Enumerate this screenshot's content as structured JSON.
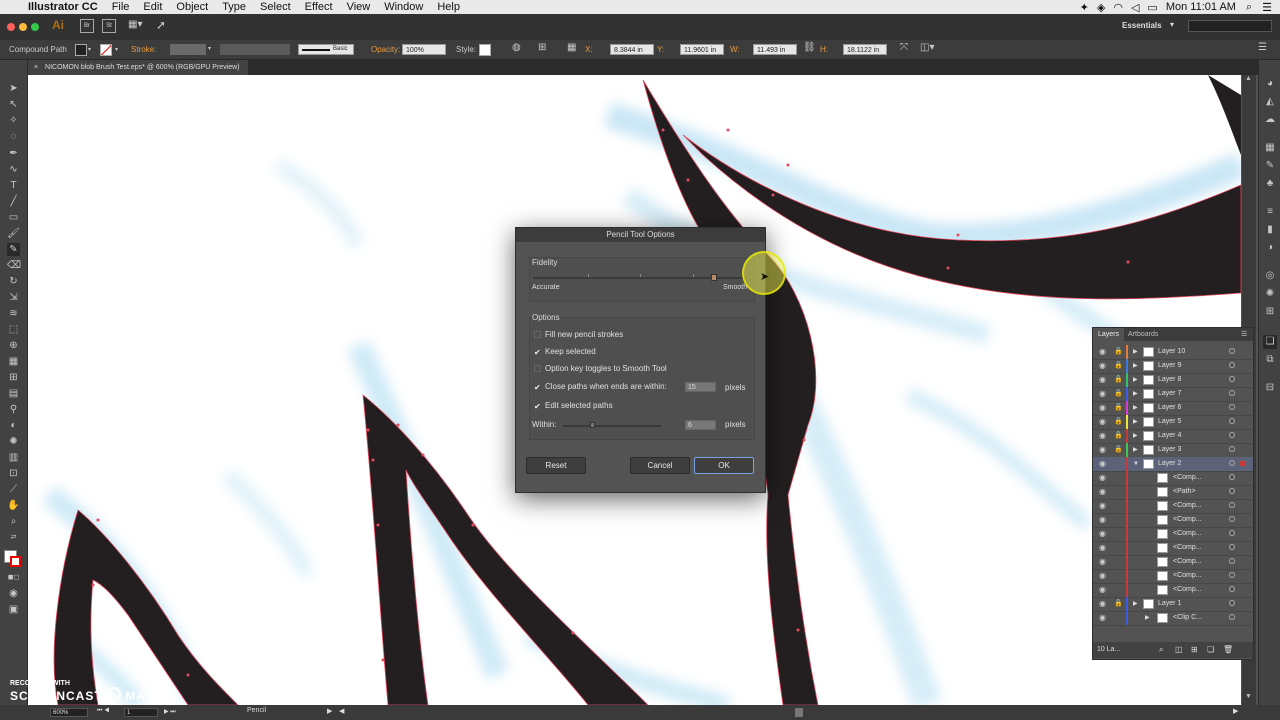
{
  "menubar": {
    "app_name": "Illustrator CC",
    "items": [
      "File",
      "Edit",
      "Object",
      "Type",
      "Select",
      "Effect",
      "View",
      "Window",
      "Help"
    ],
    "clock": "Mon 11:01 AM"
  },
  "appbar": {
    "logo": "Ai",
    "btn_br": "Br",
    "btn_st": "St",
    "workspace": "Essentials"
  },
  "control_bar": {
    "selection_type": "Compound Path",
    "stroke_label": "Stroke:",
    "brush_label": "Basic",
    "opacity_label": "Opacity:",
    "opacity_value": "100%",
    "style_label": "Style:",
    "x_label": "X:",
    "x_value": "8.3844 in",
    "y_label": "Y:",
    "y_value": "11.9601 in",
    "w_label": "W:",
    "w_value": "11.493 in",
    "h_label": "H:",
    "h_value": "18.1122 in"
  },
  "document_tab": {
    "title": "NICOMON blob Brush Test.eps* @ 600% (RGB/GPU Preview)"
  },
  "dialog": {
    "title": "Pencil Tool Options",
    "fidelity_label": "Fidelity",
    "fidelity_min": "Accurate",
    "fidelity_max": "Smooth",
    "fidelity_value_fraction": 0.85,
    "options_label": "Options",
    "opt_fill": "Fill new pencil strokes",
    "opt_fill_checked": false,
    "opt_keep": "Keep selected",
    "opt_keep_checked": true,
    "opt_option_key": "Option key toggles to Smooth Tool",
    "opt_option_key_checked": false,
    "opt_close": "Close paths when ends are within:",
    "opt_close_checked": true,
    "close_value": "15",
    "close_unit": "pixels",
    "opt_edit": "Edit selected paths",
    "opt_edit_checked": true,
    "within_label": "Within:",
    "within_value": "6",
    "within_unit": "pixels",
    "within_value_fraction": 0.3,
    "reset_label": "Reset",
    "cancel_label": "Cancel",
    "ok_label": "OK"
  },
  "layers_panel": {
    "tab_layers": "Layers",
    "tab_artboards": "Artboards",
    "rows": [
      {
        "name": "Layer 10",
        "color": "#e87b3a",
        "kind": "layer",
        "locked": true
      },
      {
        "name": "Layer 9",
        "color": "#3a7be8",
        "kind": "layer",
        "locked": true
      },
      {
        "name": "Layer 8",
        "color": "#2fc46a",
        "kind": "layer",
        "locked": true
      },
      {
        "name": "Layer 7",
        "color": "#3a5ae8",
        "kind": "layer",
        "locked": true
      },
      {
        "name": "Layer 6",
        "color": "#d83ad8",
        "kind": "layer",
        "locked": true
      },
      {
        "name": "Layer 5",
        "color": "#e8e83a",
        "kind": "layer",
        "locked": true
      },
      {
        "name": "Layer 4",
        "color": "#c83a3a",
        "kind": "layer",
        "locked": true
      },
      {
        "name": "Layer 3",
        "color": "#3ac850",
        "kind": "layer",
        "locked": true
      },
      {
        "name": "Layer 2",
        "color": "#c83a3a",
        "kind": "layer",
        "locked": false,
        "selected": true
      },
      {
        "name": "<Comp...",
        "color": "#c83a3a",
        "kind": "sub",
        "locked": false
      },
      {
        "name": "<Path>",
        "color": "#c83a3a",
        "kind": "sub",
        "locked": false
      },
      {
        "name": "<Comp...",
        "color": "#c83a3a",
        "kind": "sub",
        "locked": false
      },
      {
        "name": "<Comp...",
        "color": "#c83a3a",
        "kind": "sub",
        "locked": false
      },
      {
        "name": "<Comp...",
        "color": "#c83a3a",
        "kind": "sub",
        "locked": false
      },
      {
        "name": "<Comp...",
        "color": "#c83a3a",
        "kind": "sub",
        "locked": false
      },
      {
        "name": "<Comp...",
        "color": "#c83a3a",
        "kind": "sub",
        "locked": false
      },
      {
        "name": "<Comp...",
        "color": "#c83a3a",
        "kind": "sub",
        "locked": false
      },
      {
        "name": "<Comp...",
        "color": "#c83a3a",
        "kind": "sub",
        "locked": false
      },
      {
        "name": "Layer 1",
        "color": "#3a5ae8",
        "kind": "layer",
        "locked": true
      },
      {
        "name": "<Clip C...",
        "color": "#3a5ae8",
        "kind": "sub",
        "locked": false
      }
    ],
    "layer_count": "10 La..."
  },
  "status_bar": {
    "zoom": "600%",
    "artboard": "1",
    "tool": "Pencil"
  },
  "watermark": {
    "line1": "RECORDED WITH",
    "line2": "SCREENCAST",
    "line3": "MATIC"
  }
}
